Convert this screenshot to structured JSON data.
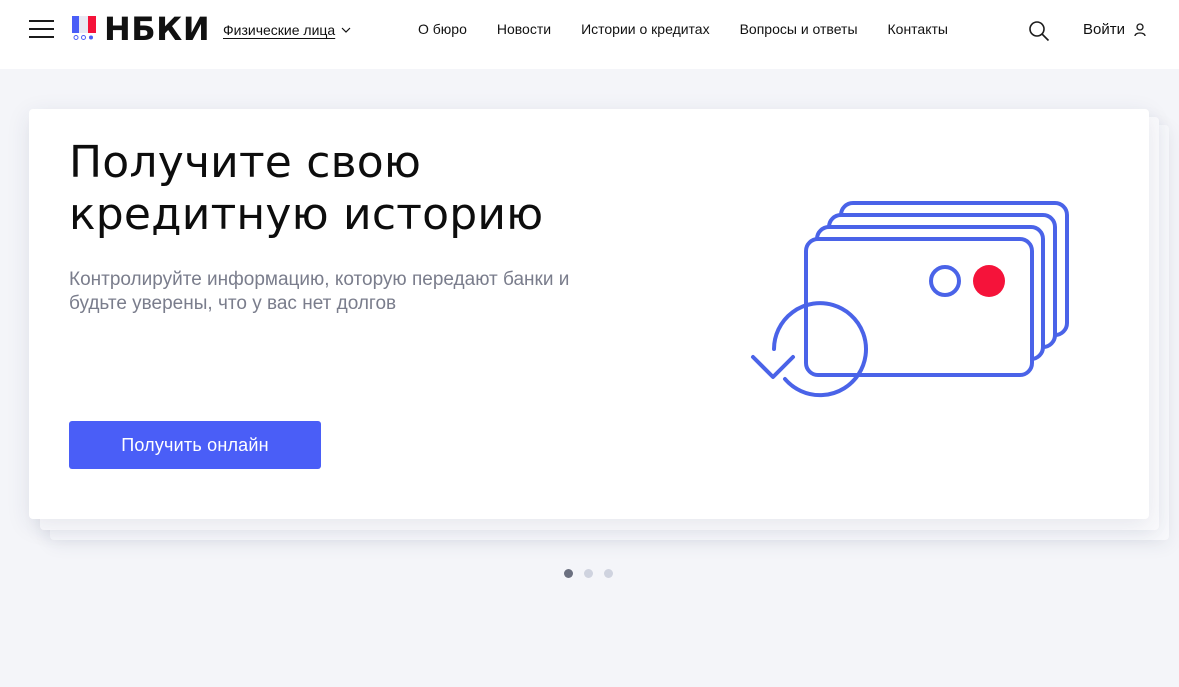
{
  "header": {
    "logo_text": "НБКИ",
    "segment_label": "Физические лица",
    "nav": [
      {
        "label": "О бюро"
      },
      {
        "label": "Новости"
      },
      {
        "label": "Истории о кредитах"
      },
      {
        "label": "Вопросы и ответы"
      },
      {
        "label": "Контакты"
      }
    ],
    "login_label": "Войти",
    "icons": {
      "menu": "hamburger-icon",
      "search": "search-icon",
      "user": "user-icon",
      "chevron": "chevron-down-icon"
    }
  },
  "hero": {
    "title_line1": "Получите свою",
    "title_line2": "кредитную историю",
    "subtitle_line1": "Контролируйте информацию, которую передают банки и",
    "subtitle_line2": "будьте уверены, что у вас нет долгов",
    "cta_label": "Получить онлайн"
  },
  "carousel": {
    "active_index": 0,
    "slide_count": 3
  },
  "colors": {
    "accent": "#4a5ef7",
    "illustration_stroke": "#4a63e8",
    "illustration_red": "#f5133a",
    "background": "#f4f5f9"
  }
}
